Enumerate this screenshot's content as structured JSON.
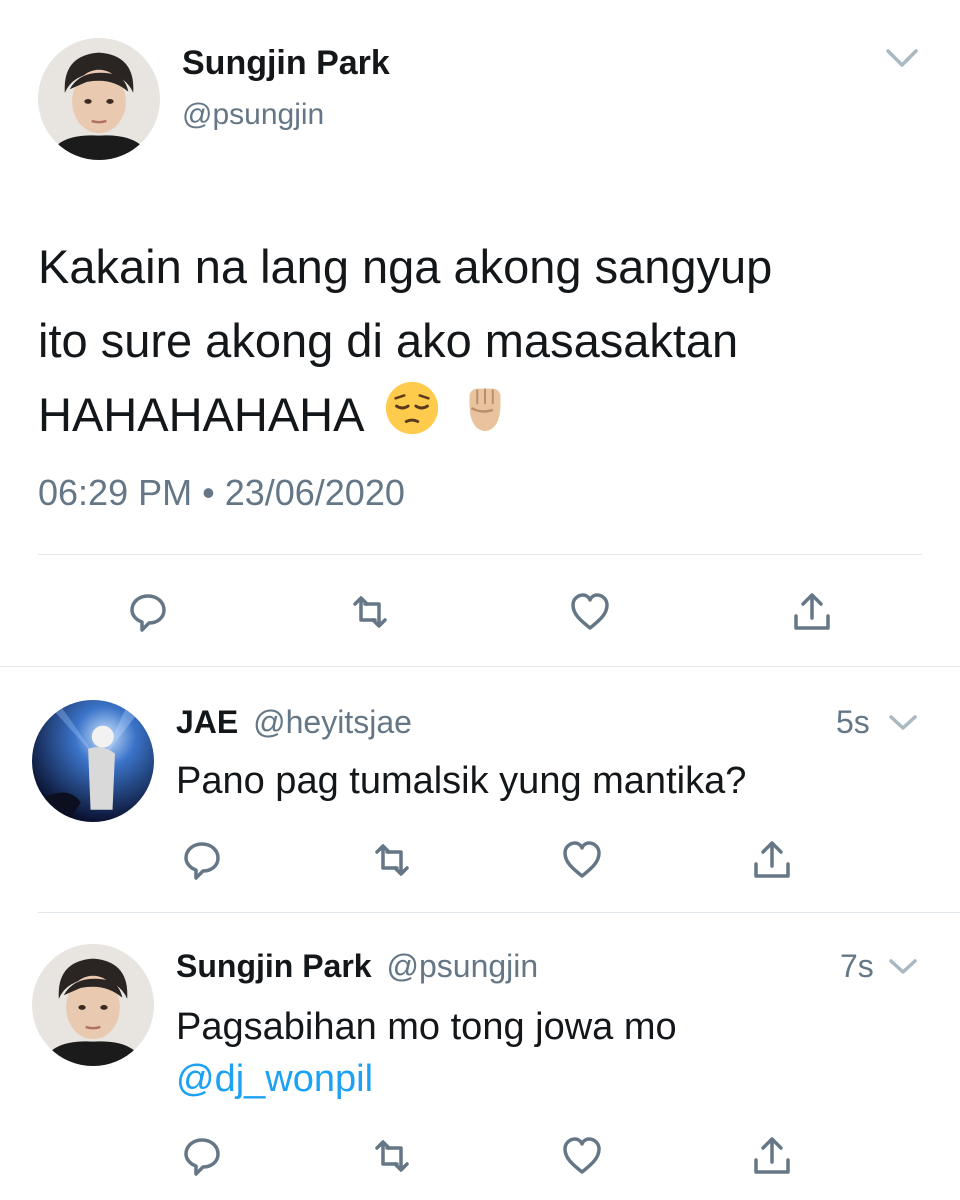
{
  "main_tweet": {
    "author_name": "Sungjin Park",
    "author_handle": "@psungjin",
    "text_line1": "Kakain na lang nga akong sangyup",
    "text_line2": "ito sure akong di ako masasaktan",
    "text_line3": "HAHAHAHAHA",
    "emojis": [
      "pensive-face-emoji",
      "raised-fist-emoji"
    ],
    "timestamp": "06:29 PM • 23/06/2020",
    "actions": [
      "reply-icon",
      "retweet-icon",
      "like-icon",
      "share-icon"
    ]
  },
  "replies": [
    {
      "author_name": "JAE",
      "author_handle": "@heyitsjae",
      "time": "5s",
      "text": "Pano pag tumalsik yung mantika?"
    },
    {
      "author_name": "Sungjin Park",
      "author_handle": "@psungjin",
      "time": "7s",
      "text": "Pagsabihan mo tong jowa mo",
      "mention": "@dj_wonpil"
    }
  ],
  "colors": {
    "text": "#14171a",
    "secondary": "#657786",
    "link": "#1da1f2",
    "divider": "#e1e8ed"
  }
}
